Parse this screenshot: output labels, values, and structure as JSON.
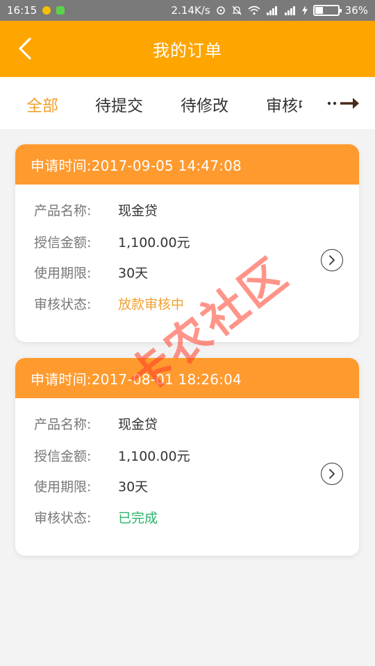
{
  "statusbar": {
    "time": "16:15",
    "net_speed": "2.14K/s",
    "battery": "36%",
    "battery_level": 0.36
  },
  "header": {
    "title": "我的订单",
    "back_icon": "chevron-left-icon"
  },
  "tabs": [
    {
      "label": "全部",
      "active": true
    },
    {
      "label": "待提交",
      "active": false
    },
    {
      "label": "待修改",
      "active": false
    },
    {
      "label": "审核中",
      "active": false
    }
  ],
  "tabs_more_icon": "dots-arrow-right-icon",
  "labels": {
    "product": "产品名称:",
    "amount": "授信金额:",
    "term": "使用期限:",
    "status": "审核状态:"
  },
  "orders": [
    {
      "header": "申请时间:2017-09-05 14:47:08",
      "product": "现金贷",
      "amount": "1,100.00元",
      "term": "30天",
      "status": "放款审核中"
    },
    {
      "header": "申请时间:2017-08-01 18:26:04",
      "product": "现金贷",
      "amount": "1,100.00元",
      "term": "30天",
      "status": "已完成"
    }
  ],
  "watermark": "卡农社区",
  "colors": {
    "header_bg": "#ffa500",
    "card_head_bg": "#ff9a2e",
    "pending": "#f0a030",
    "done": "#29b36a"
  }
}
